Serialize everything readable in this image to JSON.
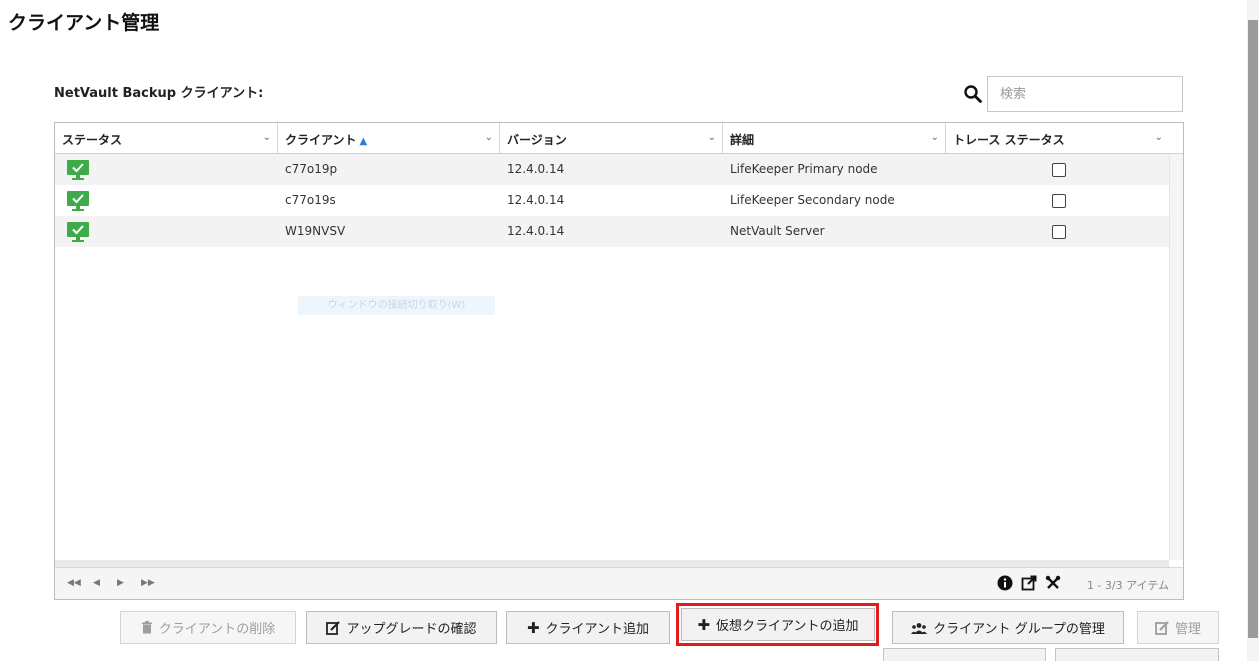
{
  "page": {
    "title": "クライアント管理"
  },
  "section": {
    "label": "NetVault Backup クライアント:"
  },
  "search": {
    "placeholder": "検索"
  },
  "grid": {
    "columns": [
      {
        "label": "ステータス"
      },
      {
        "label": "クライアント"
      },
      {
        "label": "バージョン"
      },
      {
        "label": "詳細"
      },
      {
        "label": "トレース ステータス"
      }
    ],
    "sorted_column_index": 1,
    "sort_direction": "ascending",
    "rows": [
      {
        "status": "online",
        "client": "c77o19p",
        "version": "12.4.0.14",
        "details": "LifeKeeper Primary node",
        "trace_checked": false
      },
      {
        "status": "online",
        "client": "c77o19s",
        "version": "12.4.0.14",
        "details": "LifeKeeper Secondary node",
        "trace_checked": false
      },
      {
        "status": "online",
        "client": "W19NVSV",
        "version": "12.4.0.14",
        "details": "NetVault Server",
        "trace_checked": false
      }
    ],
    "tooltip_ghost": "ウィンドウの接続切り取り(W)",
    "footer": {
      "item_count": "1 - 3/3 アイテム"
    }
  },
  "buttons": {
    "delete_client": "クライアントの削除",
    "check_upgrade": "アップグレードの確認",
    "add_client": "クライアント追加",
    "add_virtual_client": "仮想クライアントの追加",
    "manage_groups": "クライアント グループの管理",
    "manage": "管理"
  },
  "colors": {
    "status_online": "#3eaa4a",
    "highlight": "#e41b1b",
    "sort_arrow": "#2a7fd4"
  },
  "icons": {
    "search": "search-icon",
    "status": "monitor-check-icon",
    "delete": "trash-icon",
    "upgrade": "edit-icon",
    "add": "plus-icon",
    "groups": "users-icon",
    "manage": "edit-icon",
    "info": "info-icon",
    "export": "external-link-icon",
    "settings": "tools-icon"
  }
}
